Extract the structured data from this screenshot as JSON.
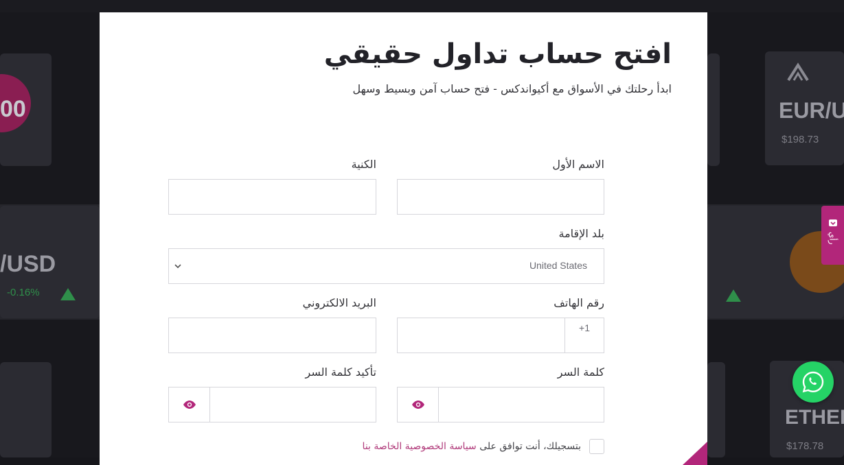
{
  "background": {
    "cards": [
      {
        "ticker": "EUR/U",
        "price": "$198.73"
      },
      {
        "ticker": "/USD",
        "change": "-0.16%"
      },
      {
        "ticker": "ETHER",
        "price": "$178.78"
      },
      {
        "ticker": "00"
      }
    ]
  },
  "form": {
    "title": "افتح حساب تداول حقيقي",
    "subtitle": "ابدأ رحلتك في الأسواق مع أكيواندكس - فتح حساب آمن وبسيط وسهل",
    "first_name": {
      "label": "الاسم الأول",
      "value": ""
    },
    "last_name": {
      "label": "الكنية",
      "value": ""
    },
    "country": {
      "label": "بلد الإقامة",
      "value": "United States"
    },
    "phone": {
      "label": "رقم الهاتف",
      "prefix": "+1",
      "value": ""
    },
    "email": {
      "label": "البريد الالكتروني",
      "value": ""
    },
    "password": {
      "label": "كلمة السر",
      "value": ""
    },
    "confirm_password": {
      "label": "تأكيد كلمة السر",
      "value": ""
    },
    "consent": {
      "text": "بتسجيلك، أنت توافق على",
      "link": "سياسة الخصوصية الخاصة بنا",
      "checked": false
    }
  },
  "side_tab": {
    "label": "رأي"
  },
  "colors": {
    "accent": "#b2267a",
    "whatsapp": "#25d366"
  }
}
